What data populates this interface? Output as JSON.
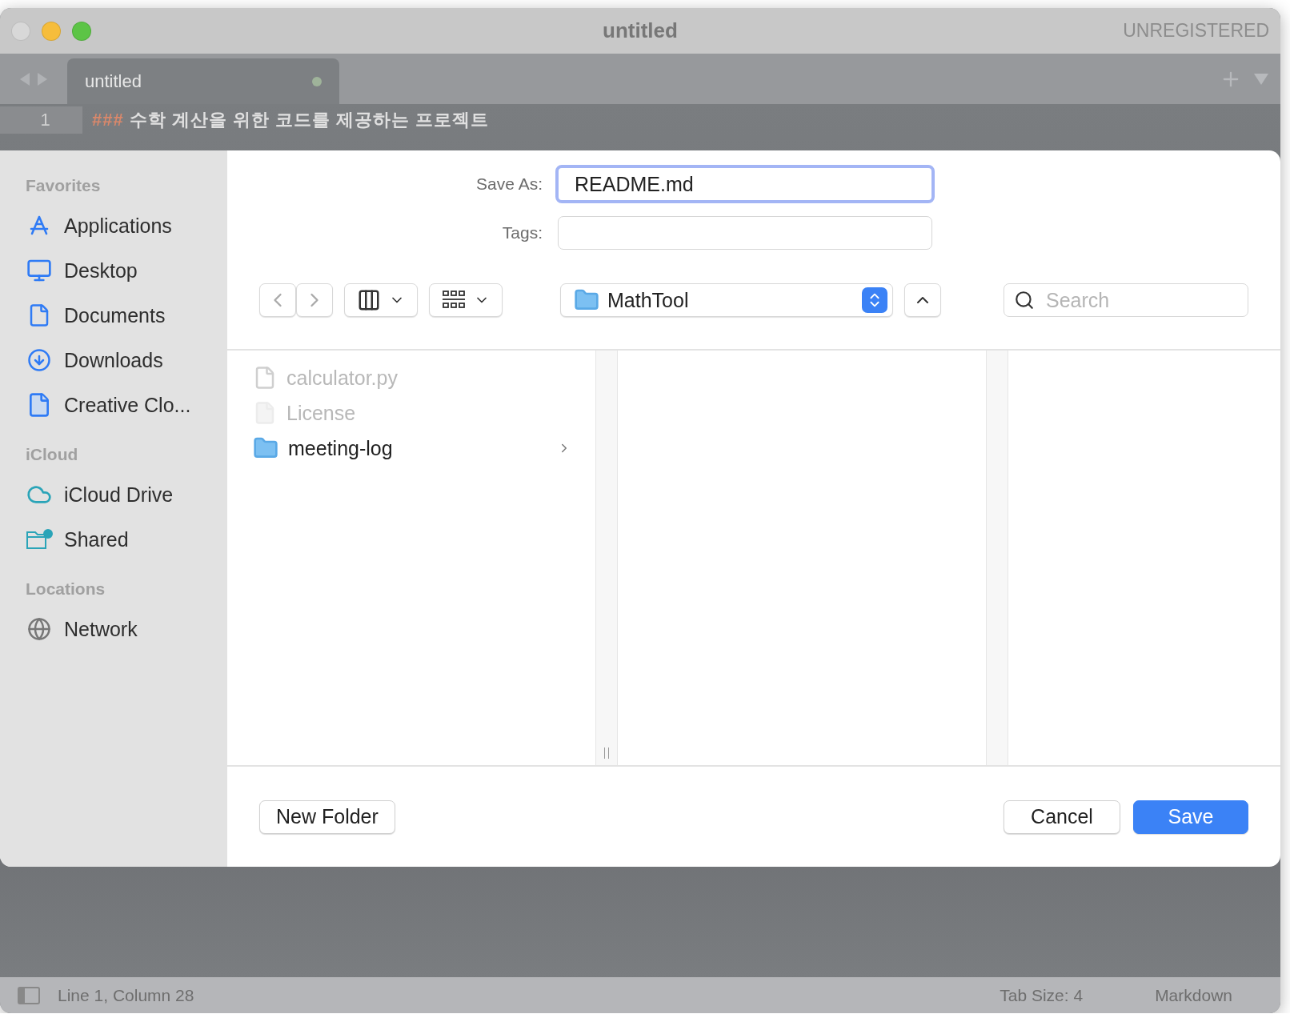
{
  "window": {
    "title": "untitled",
    "badge": "UNREGISTERED"
  },
  "tabs": [
    {
      "label": "untitled",
      "selected": true,
      "modified": true
    }
  ],
  "editor": {
    "lines": [
      {
        "number": "1",
        "marker": "###",
        "text": "수학 계산을 위한 코드를 제공하는 프로젝트"
      }
    ]
  },
  "dialog": {
    "save_as_label": "Save As:",
    "save_as_value": "README.md",
    "tags_label": "Tags:",
    "location": "MathTool",
    "search_placeholder": "Search",
    "sidebar": [
      {
        "heading": "Favorites",
        "items": [
          {
            "label": "Applications",
            "kind": "apps"
          },
          {
            "label": "Desktop",
            "kind": "desktop"
          },
          {
            "label": "Documents",
            "kind": "document"
          },
          {
            "label": "Downloads",
            "kind": "download"
          },
          {
            "label": "Creative Clo...",
            "kind": "file"
          }
        ]
      },
      {
        "heading": "iCloud",
        "items": [
          {
            "label": "iCloud Drive",
            "kind": "cloud"
          },
          {
            "label": "Shared",
            "kind": "shared"
          }
        ]
      },
      {
        "heading": "Locations",
        "items": [
          {
            "label": "Network",
            "kind": "network"
          }
        ]
      }
    ],
    "files": [
      {
        "name": "calculator.py",
        "kind": "file",
        "disabled": true
      },
      {
        "name": "License",
        "kind": "blank",
        "disabled": true
      },
      {
        "name": "meeting-log",
        "kind": "folder",
        "disabled": false
      }
    ],
    "buttons": {
      "new_folder": "New Folder",
      "cancel": "Cancel",
      "save": "Save"
    }
  },
  "status_bar": {
    "position": "Line 1, Column 28",
    "tab_size": "Tab Size: 4",
    "syntax": "Markdown"
  }
}
